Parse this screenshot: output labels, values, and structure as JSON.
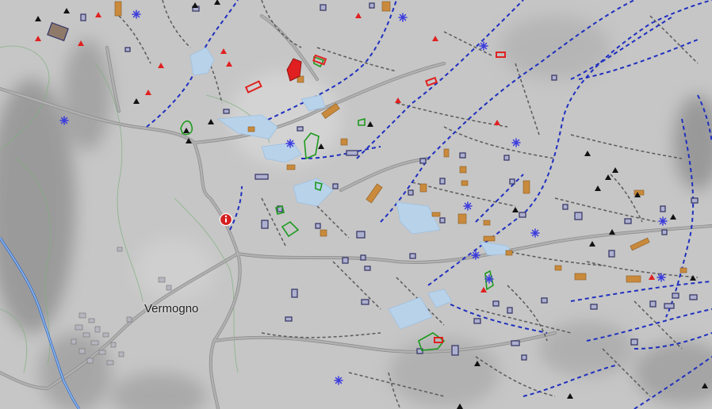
{
  "map": {
    "place_label": "Vermogno",
    "icons": {
      "info": "info-icon",
      "peak": "peak-triangle-icon",
      "hut": "hut-triangle-icon",
      "spring": "spring-asterisk-icon"
    },
    "colors": {
      "terrain": "#c9c9c9",
      "terrain_dark": "#8f8f8f",
      "road": "#a8a8a8",
      "road_edge": "#7e7e7e",
      "path": "#5a5a5a",
      "stream": "#1f2fbf",
      "water": "#b8d2ea",
      "building_fill": "#aeb0cf",
      "building_edge": "#3a3a6a",
      "barn": "#c98a3c",
      "contour": "#7fb07f",
      "green_area": "#1e9a1e",
      "red_feature": "#e02020",
      "info_marker": "#d42020"
    }
  }
}
